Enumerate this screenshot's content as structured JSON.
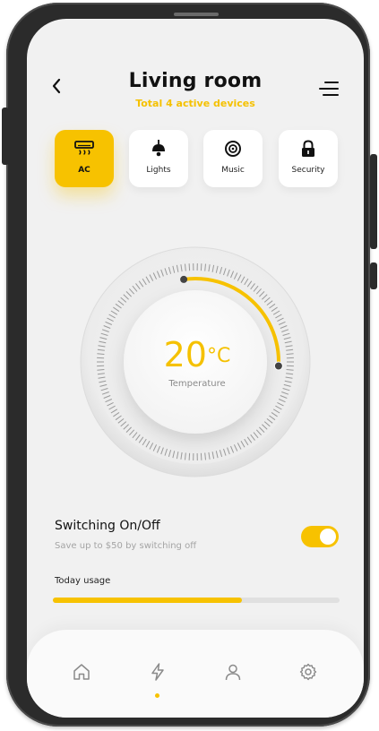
{
  "header": {
    "title": "Living room",
    "subtitle": "Total 4 active devices",
    "back_icon": "chevron-left-icon",
    "menu_icon": "menu-icon"
  },
  "devices": [
    {
      "label": "AC",
      "icon": "air-conditioner-icon",
      "active": true
    },
    {
      "label": "Lights",
      "icon": "lamp-icon",
      "active": false
    },
    {
      "label": "Music",
      "icon": "speaker-icon",
      "active": false
    },
    {
      "label": "Security",
      "icon": "lock-icon",
      "active": false
    }
  ],
  "thermostat": {
    "value": "20",
    "unit": "°C",
    "label": "Temperature",
    "arc_fraction": 0.28
  },
  "switching": {
    "title": "Switching On/Off",
    "subtitle": "Save up to $50 by switching off",
    "on": true
  },
  "usage": {
    "label": "Today usage",
    "fraction": 0.66
  },
  "bottom_nav": [
    {
      "icon": "home-icon",
      "active": false
    },
    {
      "icon": "lightning-icon",
      "active": true
    },
    {
      "icon": "user-icon",
      "active": false
    },
    {
      "icon": "gear-icon",
      "active": false
    }
  ],
  "colors": {
    "accent": "#f7c200",
    "background": "#f1f1f1",
    "text": "#111111",
    "muted": "#a4a4a4"
  }
}
